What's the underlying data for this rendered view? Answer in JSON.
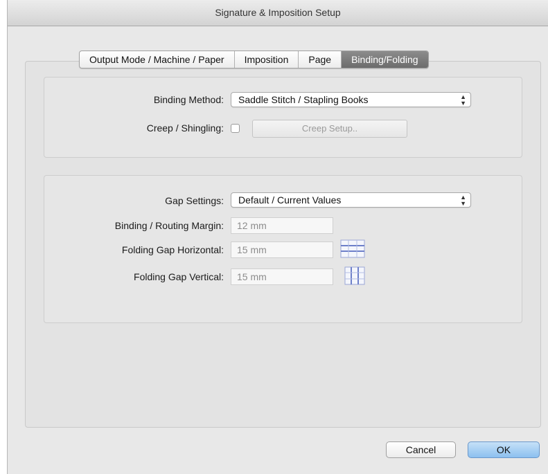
{
  "window": {
    "title": "Signature & Imposition Setup"
  },
  "tabs": [
    {
      "label": "Output Mode / Machine / Paper",
      "active": false
    },
    {
      "label": "Imposition",
      "active": false
    },
    {
      "label": "Page",
      "active": false
    },
    {
      "label": "Binding/Folding",
      "active": true
    }
  ],
  "binding": {
    "method_label": "Binding Method:",
    "method_value": "Saddle Stitch / Stapling Books",
    "creep_label": "Creep / Shingling:",
    "creep_checked": false,
    "creep_button": "Creep Setup.."
  },
  "gap": {
    "settings_label": "Gap Settings:",
    "settings_value": "Default / Current Values",
    "margin_label": "Binding / Routing Margin:",
    "margin_value": "12 mm",
    "horizontal_label": "Folding Gap Horizontal:",
    "horizontal_value": "15 mm",
    "vertical_label": "Folding Gap Vertical:",
    "vertical_value": "15 mm"
  },
  "buttons": {
    "cancel": "Cancel",
    "ok": "OK"
  },
  "colors": {
    "accent": "#8cc0ef",
    "active_tab": "#7a7a7a",
    "grid_icon": "#7b8fd0"
  }
}
